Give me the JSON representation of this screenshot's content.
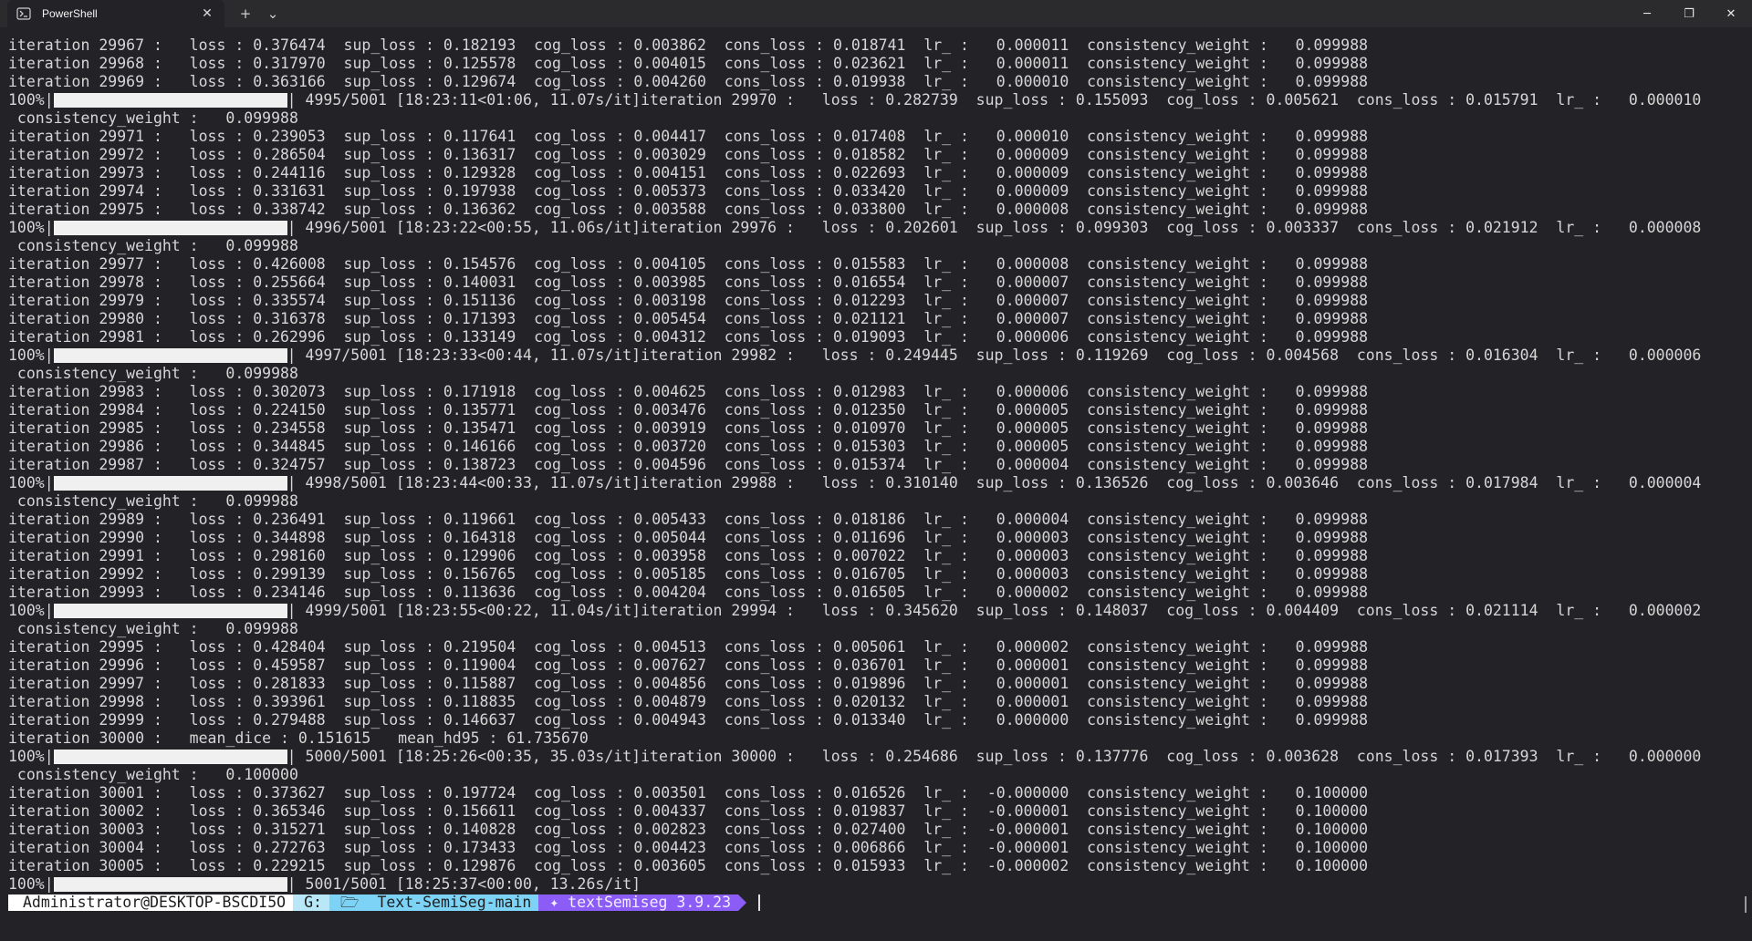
{
  "window": {
    "tab_title": "PowerShell",
    "tab_icon": "powershell-icon",
    "close_tab": "✕",
    "new_tab": "+",
    "dropdown": "⌄",
    "minimize": "─",
    "restore": "❐",
    "close": "✕"
  },
  "lines": [
    "iteration 29967 :   loss : 0.376474  sup_loss : 0.182193  cog_loss : 0.003862  cons_loss : 0.018741  lr_ :   0.000011  consistency_weight :   0.099988",
    "iteration 29968 :   loss : 0.317970  sup_loss : 0.125578  cog_loss : 0.004015  cons_loss : 0.023621  lr_ :   0.000011  consistency_weight :   0.099988",
    "iteration 29969 :   loss : 0.363166  sup_loss : 0.129674  cog_loss : 0.004260  cons_loss : 0.019938  lr_ :   0.000010  consistency_weight :   0.099988",
    {
      "progress": "100%|",
      "rest": "| 4995/5001 [18:23:11<01:06, 11.07s/it]iteration 29970 :   loss : 0.282739  sup_loss : 0.155093  cog_loss : 0.005621  cons_loss : 0.015791  lr_ :   0.000010"
    },
    " consistency_weight :   0.099988",
    "iteration 29971 :   loss : 0.239053  sup_loss : 0.117641  cog_loss : 0.004417  cons_loss : 0.017408  lr_ :   0.000010  consistency_weight :   0.099988",
    "iteration 29972 :   loss : 0.286504  sup_loss : 0.136317  cog_loss : 0.003029  cons_loss : 0.018582  lr_ :   0.000009  consistency_weight :   0.099988",
    "iteration 29973 :   loss : 0.244116  sup_loss : 0.129328  cog_loss : 0.004151  cons_loss : 0.022693  lr_ :   0.000009  consistency_weight :   0.099988",
    "iteration 29974 :   loss : 0.331631  sup_loss : 0.197938  cog_loss : 0.005373  cons_loss : 0.033420  lr_ :   0.000009  consistency_weight :   0.099988",
    "iteration 29975 :   loss : 0.338742  sup_loss : 0.136362  cog_loss : 0.003588  cons_loss : 0.033800  lr_ :   0.000008  consistency_weight :   0.099988",
    {
      "progress": "100%|",
      "rest": "| 4996/5001 [18:23:22<00:55, 11.06s/it]iteration 29976 :   loss : 0.202601  sup_loss : 0.099303  cog_loss : 0.003337  cons_loss : 0.021912  lr_ :   0.000008"
    },
    " consistency_weight :   0.099988",
    "iteration 29977 :   loss : 0.426008  sup_loss : 0.154576  cog_loss : 0.004105  cons_loss : 0.015583  lr_ :   0.000008  consistency_weight :   0.099988",
    "iteration 29978 :   loss : 0.255664  sup_loss : 0.140031  cog_loss : 0.003985  cons_loss : 0.016554  lr_ :   0.000007  consistency_weight :   0.099988",
    "iteration 29979 :   loss : 0.335574  sup_loss : 0.151136  cog_loss : 0.003198  cons_loss : 0.012293  lr_ :   0.000007  consistency_weight :   0.099988",
    "iteration 29980 :   loss : 0.316378  sup_loss : 0.171393  cog_loss : 0.005454  cons_loss : 0.021121  lr_ :   0.000007  consistency_weight :   0.099988",
    "iteration 29981 :   loss : 0.262996  sup_loss : 0.133149  cog_loss : 0.004312  cons_loss : 0.019093  lr_ :   0.000006  consistency_weight :   0.099988",
    {
      "progress": "100%|",
      "rest": "| 4997/5001 [18:23:33<00:44, 11.07s/it]iteration 29982 :   loss : 0.249445  sup_loss : 0.119269  cog_loss : 0.004568  cons_loss : 0.016304  lr_ :   0.000006"
    },
    " consistency_weight :   0.099988",
    "iteration 29983 :   loss : 0.302073  sup_loss : 0.171918  cog_loss : 0.004625  cons_loss : 0.012983  lr_ :   0.000006  consistency_weight :   0.099988",
    "iteration 29984 :   loss : 0.224150  sup_loss : 0.135771  cog_loss : 0.003476  cons_loss : 0.012350  lr_ :   0.000005  consistency_weight :   0.099988",
    "iteration 29985 :   loss : 0.234558  sup_loss : 0.135471  cog_loss : 0.003919  cons_loss : 0.010970  lr_ :   0.000005  consistency_weight :   0.099988",
    "iteration 29986 :   loss : 0.344845  sup_loss : 0.146166  cog_loss : 0.003720  cons_loss : 0.015303  lr_ :   0.000005  consistency_weight :   0.099988",
    "iteration 29987 :   loss : 0.324757  sup_loss : 0.138723  cog_loss : 0.004596  cons_loss : 0.015374  lr_ :   0.000004  consistency_weight :   0.099988",
    {
      "progress": "100%|",
      "rest": "| 4998/5001 [18:23:44<00:33, 11.07s/it]iteration 29988 :   loss : 0.310140  sup_loss : 0.136526  cog_loss : 0.003646  cons_loss : 0.017984  lr_ :   0.000004"
    },
    " consistency_weight :   0.099988",
    "iteration 29989 :   loss : 0.236491  sup_loss : 0.119661  cog_loss : 0.005433  cons_loss : 0.018186  lr_ :   0.000004  consistency_weight :   0.099988",
    "iteration 29990 :   loss : 0.344898  sup_loss : 0.164318  cog_loss : 0.005044  cons_loss : 0.011696  lr_ :   0.000003  consistency_weight :   0.099988",
    "iteration 29991 :   loss : 0.298160  sup_loss : 0.129906  cog_loss : 0.003958  cons_loss : 0.007022  lr_ :   0.000003  consistency_weight :   0.099988",
    "iteration 29992 :   loss : 0.299139  sup_loss : 0.156765  cog_loss : 0.005185  cons_loss : 0.016705  lr_ :   0.000003  consistency_weight :   0.099988",
    "iteration 29993 :   loss : 0.234146  sup_loss : 0.113636  cog_loss : 0.004204  cons_loss : 0.016505  lr_ :   0.000002  consistency_weight :   0.099988",
    {
      "progress": "100%|",
      "rest": "| 4999/5001 [18:23:55<00:22, 11.04s/it]iteration 29994 :   loss : 0.345620  sup_loss : 0.148037  cog_loss : 0.004409  cons_loss : 0.021114  lr_ :   0.000002"
    },
    " consistency_weight :   0.099988",
    "iteration 29995 :   loss : 0.428404  sup_loss : 0.219504  cog_loss : 0.004513  cons_loss : 0.005061  lr_ :   0.000002  consistency_weight :   0.099988",
    "iteration 29996 :   loss : 0.459587  sup_loss : 0.119004  cog_loss : 0.007627  cons_loss : 0.036701  lr_ :   0.000001  consistency_weight :   0.099988",
    "iteration 29997 :   loss : 0.281833  sup_loss : 0.115887  cog_loss : 0.004856  cons_loss : 0.019896  lr_ :   0.000001  consistency_weight :   0.099988",
    "iteration 29998 :   loss : 0.393961  sup_loss : 0.118835  cog_loss : 0.004879  cons_loss : 0.020132  lr_ :   0.000001  consistency_weight :   0.099988",
    "iteration 29999 :   loss : 0.279488  sup_loss : 0.146637  cog_loss : 0.004943  cons_loss : 0.013340  lr_ :   0.000000  consistency_weight :   0.099988",
    "iteration 30000 :   mean_dice : 0.151615   mean_hd95 : 61.735670",
    {
      "progress": "100%|",
      "rest": "| 5000/5001 [18:25:26<00:35, 35.03s/it]iteration 30000 :   loss : 0.254686  sup_loss : 0.137776  cog_loss : 0.003628  cons_loss : 0.017393  lr_ :   0.000000"
    },
    " consistency_weight :   0.100000",
    "iteration 30001 :   loss : 0.373627  sup_loss : 0.197724  cog_loss : 0.003501  cons_loss : 0.016526  lr_ :  -0.000000  consistency_weight :   0.100000",
    "iteration 30002 :   loss : 0.365346  sup_loss : 0.156611  cog_loss : 0.004337  cons_loss : 0.019837  lr_ :  -0.000001  consistency_weight :   0.100000",
    "iteration 30003 :   loss : 0.315271  sup_loss : 0.140828  cog_loss : 0.002823  cons_loss : 0.027400  lr_ :  -0.000001  consistency_weight :   0.100000",
    "iteration 30004 :   loss : 0.272763  sup_loss : 0.173433  cog_loss : 0.004423  cons_loss : 0.006866  lr_ :  -0.000001  consistency_weight :   0.100000",
    "iteration 30005 :   loss : 0.229215  sup_loss : 0.129876  cog_loss : 0.003605  cons_loss : 0.015933  lr_ :  -0.000002  consistency_weight :   0.100000",
    {
      "progress": "100%|",
      "rest": "| 5001/5001 [18:25:37<00:00, 13.26s/it]"
    }
  ],
  "prompt": {
    "user": "Administrator@DESKTOP-BSCDI5O",
    "drive": "G:",
    "folder_icon": "🗁",
    "path": "Text-SemiSeg-main",
    "env_icon": "python-icon",
    "env": "textSemiseg 3.9.23"
  },
  "colors": {
    "background": "#232327",
    "text": "#d6d6d6",
    "progress_fill": "#f0f0f0",
    "prompt_user_bg": "#ffffff",
    "prompt_drive_bg": "#b8e7f8",
    "prompt_path_bg": "#7dd3f6",
    "prompt_env_bg": "#8b5cf6"
  }
}
